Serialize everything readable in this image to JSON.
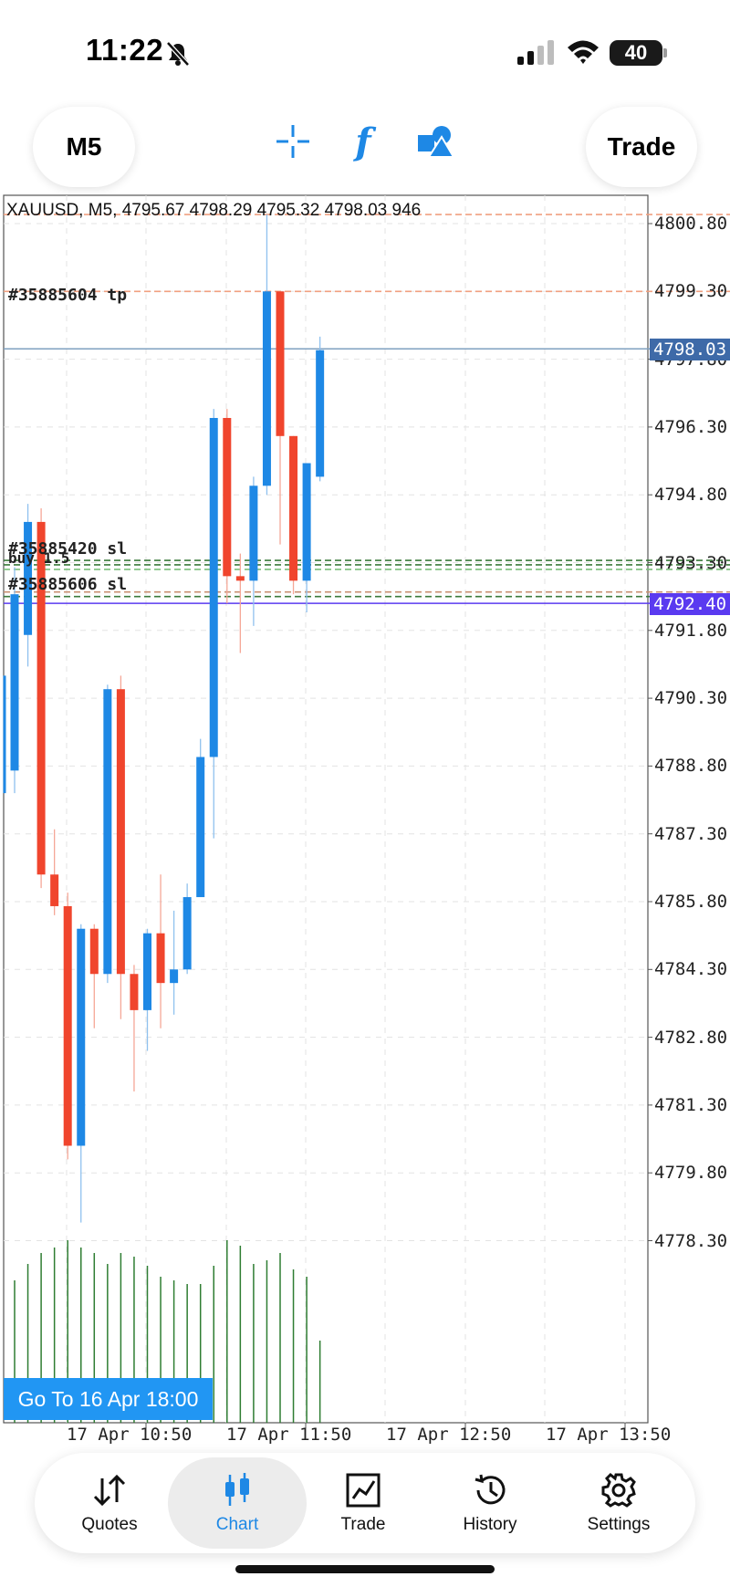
{
  "status_bar": {
    "time": "11:22",
    "battery": "40"
  },
  "toolbar": {
    "timeframe": "M5",
    "trade_label": "Trade",
    "icons": [
      "crosshair-icon",
      "function-icon",
      "shapes-icon"
    ],
    "function_glyph": "f"
  },
  "chart": {
    "info_line": "XAUUSD, M5, 4795.67 4798.29 4795.32 4798.03 946",
    "order_labels": {
      "tp_label": "#35885604 tp",
      "sl_upper_label": "#35885420 sl",
      "buy_label": "buy 1.5",
      "sl_lower_label": "#35885606 sl"
    },
    "bid_price": "4798.03",
    "ask_price": "4792.40",
    "goto_label": "Go To 16 Apr 18:00",
    "colors": {
      "bull": "#1e88e5",
      "bear": "#f0452d",
      "volume": "#2e7d32",
      "grid": "#e3e3e3"
    }
  },
  "chart_data": {
    "type": "candlestick",
    "symbol": "XAUUSD",
    "timeframe": "M5",
    "y_ticks": [
      "4800.80",
      "4799.30",
      "4797.80",
      "4796.30",
      "4794.80",
      "4793.30",
      "4791.80",
      "4790.30",
      "4788.80",
      "4787.30",
      "4785.80",
      "4784.30",
      "4782.80",
      "4781.30",
      "4779.80",
      "4778.30"
    ],
    "x_ticks": [
      "17 Apr 10:50",
      "17 Apr 11:50",
      "17 Apr 12:50",
      "17 Apr 13:50"
    ],
    "ylim": [
      4776.8,
      4801.6
    ],
    "candles": [
      {
        "o": 4788.7,
        "h": 4793.2,
        "l": 4788.2,
        "c": 4792.6
      },
      {
        "o": 4791.7,
        "h": 4794.6,
        "l": 4791.0,
        "c": 4794.2
      },
      {
        "o": 4794.2,
        "h": 4794.5,
        "l": 4786.1,
        "c": 4786.4
      },
      {
        "o": 4786.4,
        "h": 4787.4,
        "l": 4785.5,
        "c": 4785.7
      },
      {
        "o": 4785.7,
        "h": 4786.0,
        "l": 4780.1,
        "c": 4780.4
      },
      {
        "o": 4780.4,
        "h": 4785.3,
        "l": 4778.7,
        "c": 4785.2
      },
      {
        "o": 4785.2,
        "h": 4785.3,
        "l": 4783.0,
        "c": 4784.2
      },
      {
        "o": 4784.2,
        "h": 4790.6,
        "l": 4784.0,
        "c": 4790.5
      },
      {
        "o": 4790.5,
        "h": 4790.8,
        "l": 4783.2,
        "c": 4784.2
      },
      {
        "o": 4784.2,
        "h": 4784.4,
        "l": 4781.6,
        "c": 4783.4
      },
      {
        "o": 4783.4,
        "h": 4785.2,
        "l": 4782.5,
        "c": 4785.1
      },
      {
        "o": 4785.1,
        "h": 4786.4,
        "l": 4783.0,
        "c": 4784.0
      },
      {
        "o": 4784.0,
        "h": 4785.6,
        "l": 4783.3,
        "c": 4784.3
      },
      {
        "o": 4784.3,
        "h": 4786.2,
        "l": 4784.2,
        "c": 4785.9
      },
      {
        "o": 4785.9,
        "h": 4789.4,
        "l": 4785.9,
        "c": 4789.0
      },
      {
        "o": 4789.0,
        "h": 4796.7,
        "l": 4787.2,
        "c": 4796.5
      },
      {
        "o": 4796.5,
        "h": 4796.7,
        "l": 4792.4,
        "c": 4793.0
      },
      {
        "o": 4793.0,
        "h": 4793.5,
        "l": 4791.3,
        "c": 4792.9
      },
      {
        "o": 4792.9,
        "h": 4795.2,
        "l": 4791.9,
        "c": 4795.0
      },
      {
        "o": 4795.0,
        "h": 4801.0,
        "l": 4794.8,
        "c": 4799.3
      },
      {
        "o": 4799.3,
        "h": 4799.3,
        "l": 4793.7,
        "c": 4796.1
      },
      {
        "o": 4796.1,
        "h": 4796.1,
        "l": 4792.6,
        "c": 4792.9
      },
      {
        "o": 4792.9,
        "h": 4795.5,
        "l": 4792.2,
        "c": 4795.5
      },
      {
        "o": 4795.2,
        "h": 4798.3,
        "l": 4795.1,
        "c": 4798.0
      }
    ],
    "volume_level": [
      0.78,
      0.87,
      0.93,
      0.96,
      1.0,
      0.96,
      0.93,
      0.87,
      0.93,
      0.91,
      0.86,
      0.8,
      0.78,
      0.76,
      0.76,
      0.86,
      1.0,
      0.97,
      0.87,
      0.89,
      0.93,
      0.84,
      0.8,
      0.45
    ],
    "price_lines": [
      {
        "price": 4801.0,
        "color": "#f0a080",
        "style": "dashed"
      },
      {
        "price": 4799.3,
        "color": "#f0a080",
        "style": "dashed"
      },
      {
        "price": 4798.03,
        "color": "#7fa0c0",
        "style": "solid"
      },
      {
        "price": 4793.35,
        "color": "#3a7a3a",
        "style": "dashed"
      },
      {
        "price": 4793.25,
        "color": "#3a7a3a",
        "style": "dashed"
      },
      {
        "price": 4793.15,
        "color": "#7abf7a",
        "style": "dashed"
      },
      {
        "price": 4792.65,
        "color": "#c89070",
        "style": "dashed"
      },
      {
        "price": 4792.55,
        "color": "#3a7a3a",
        "style": "dashed"
      },
      {
        "price": 4792.4,
        "color": "#5a3af0",
        "style": "solid"
      }
    ]
  },
  "bottom_nav": {
    "items": [
      {
        "label": "Quotes",
        "icon": "quotes-icon"
      },
      {
        "label": "Chart",
        "icon": "chart-icon"
      },
      {
        "label": "Trade",
        "icon": "trade-icon"
      },
      {
        "label": "History",
        "icon": "history-icon"
      },
      {
        "label": "Settings",
        "icon": "settings-icon"
      }
    ],
    "active": "Chart"
  }
}
